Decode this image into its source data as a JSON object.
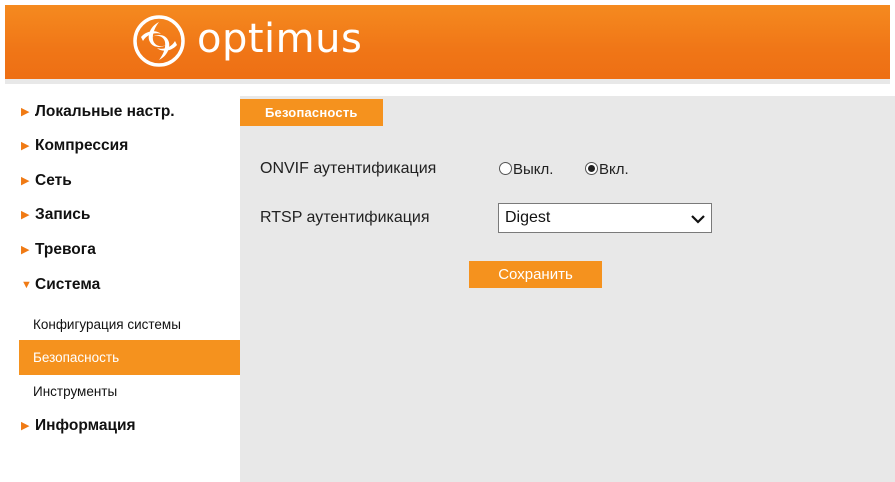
{
  "header": {
    "brand": "optimus",
    "logo_icon": "optimus-logo-icon",
    "accent": "#f07a14"
  },
  "sidebar": {
    "items": [
      {
        "label": "Локальные настр.",
        "icon": "triangle-right-icon"
      },
      {
        "label": "Компрессия",
        "icon": "triangle-right-icon"
      },
      {
        "label": "Сеть",
        "icon": "triangle-right-icon"
      },
      {
        "label": "Запись",
        "icon": "triangle-right-icon"
      },
      {
        "label": "Тревога",
        "icon": "triangle-right-icon"
      },
      {
        "label": "Система",
        "icon": "triangle-down-icon",
        "expanded": true
      },
      {
        "label": "Информация",
        "icon": "triangle-right-icon"
      }
    ],
    "sub_items": [
      {
        "label": "Конфигурация системы",
        "active": false
      },
      {
        "label": "Безопасность",
        "active": true
      },
      {
        "label": "Инструменты",
        "active": false
      }
    ]
  },
  "main": {
    "tab": "Безопасность",
    "onvif": {
      "label": "ONVIF аутентификация",
      "options": [
        "Выкл.",
        "Вкл."
      ],
      "selected": "Вкл."
    },
    "rtsp": {
      "label": "RTSP аутентификация",
      "value": "Digest"
    },
    "save_label": "Сохранить"
  },
  "colors": {
    "orange": "#f5921e",
    "content_bg": "#e8e8e8"
  }
}
